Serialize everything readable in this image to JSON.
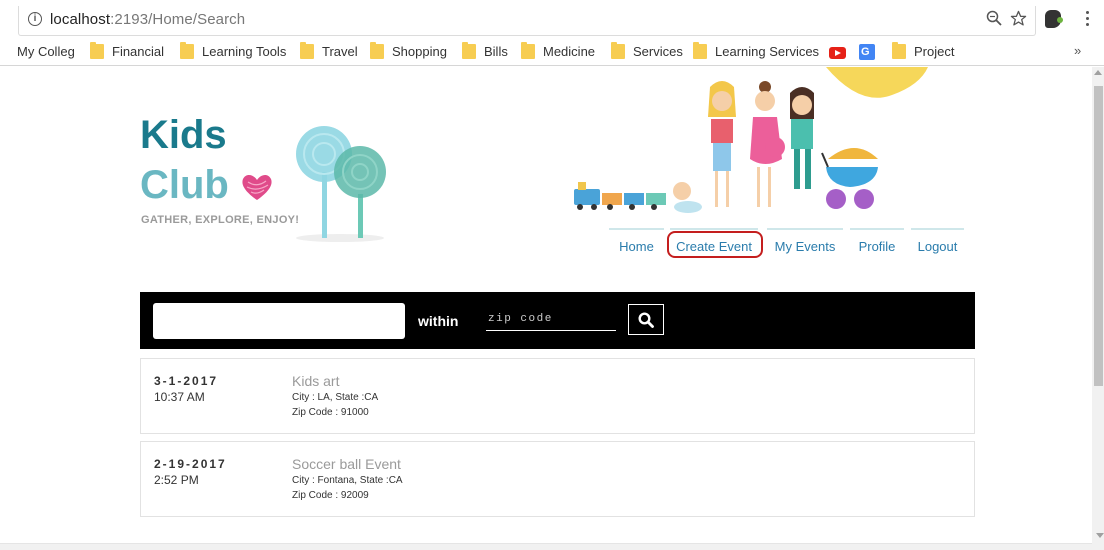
{
  "browser": {
    "url_host": "localhost",
    "url_rest": ":2193/Home/Search",
    "bookmarks": [
      {
        "label": "My Colleg",
        "icon": "none"
      },
      {
        "label": "Financial",
        "icon": "folder-icon"
      },
      {
        "label": "Learning Tools",
        "icon": "folder-icon"
      },
      {
        "label": "Travel",
        "icon": "folder-icon"
      },
      {
        "label": "Shopping",
        "icon": "folder-icon"
      },
      {
        "label": "Bills",
        "icon": "folder-icon"
      },
      {
        "label": "Medicine",
        "icon": "folder-icon"
      },
      {
        "label": "Services",
        "icon": "folder-icon"
      },
      {
        "label": "Learning Services",
        "icon": "folder-icon"
      },
      {
        "label": "",
        "icon": "youtube-icon"
      },
      {
        "label": "",
        "icon": "google-translate-icon"
      },
      {
        "label": "Project",
        "icon": "folder-icon"
      }
    ],
    "overflow_label": "»"
  },
  "logo": {
    "line1": "Kids",
    "line2": "Club",
    "tagline": "GATHER, EXPLORE, ENJOY!"
  },
  "nav": {
    "items": [
      "Home",
      "Create Event",
      "My Events",
      "Profile",
      "Logout"
    ],
    "highlighted": "Create Event"
  },
  "search": {
    "query_value": "",
    "within_label": "within",
    "zip_placeholder": "zip code"
  },
  "results": [
    {
      "date": "3-1-2017",
      "time": "10:37 AM",
      "title": "Kids art",
      "city_state": "City : LA, State :CA",
      "zip": "Zip Code : 91000"
    },
    {
      "date": "2-19-2017",
      "time": "2:52 PM",
      "title": "Soccer ball Event",
      "city_state": "City : Fontana, State :CA",
      "zip": "Zip Code : 92009"
    }
  ],
  "colors": {
    "brand_dark": "#1a7a8c",
    "brand_light": "#6ab7c2",
    "nav_link": "#2a7cac",
    "highlight": "#c41e1e"
  }
}
